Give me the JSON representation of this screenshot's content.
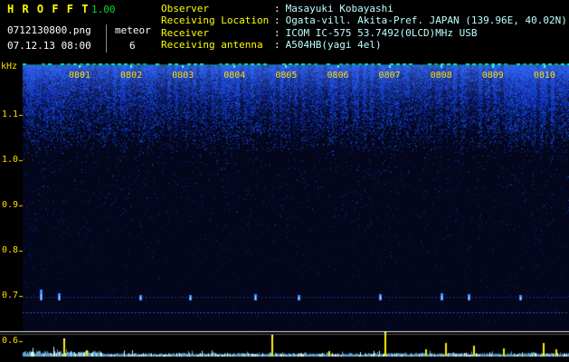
{
  "app": {
    "name": "H R O F F T",
    "version": "1.00",
    "filename": "0712130800.png",
    "counter_label": "meteor",
    "counter_value": "6",
    "timestamp": "07.12.13 08:00"
  },
  "info": {
    "rows": [
      {
        "label": "Observer",
        "sep": ":",
        "value": "Masayuki Kobayashi"
      },
      {
        "label": "Receiving Location",
        "sep": ":",
        "value": "Ogata-vill. Akita-Pref. JAPAN (139.96E, 40.02N)"
      },
      {
        "label": "Receiver",
        "sep": ":",
        "value": "ICOM IC-575 53.7492(0LCD)MHz USB"
      },
      {
        "label": "Receiving antenna",
        "sep": ":",
        "value": "A504HB(yagi 4el)"
      }
    ]
  },
  "chart_data": {
    "type": "heatmap",
    "title": "HROFFT 10-minute radio meteor spectrogram 07.12.13 08:00-08:10",
    "x_ticks": [
      "0801",
      "0802",
      "0803",
      "0804",
      "0805",
      "0806",
      "0807",
      "0808",
      "0809",
      "0810"
    ],
    "y_unit": "kHz",
    "y_ticks": [
      "1.1",
      "1.0",
      "0.9",
      "0.8",
      "0.7",
      "0.6"
    ],
    "y_range_khz": [
      0.6,
      1.2
    ],
    "carrier_lines_khz": [
      0.7,
      0.66
    ],
    "meteor_count": 6,
    "echoes": [
      {
        "x": 0.033,
        "h": 10
      },
      {
        "x": 0.066,
        "h": 6
      },
      {
        "x": 0.215,
        "h": 4
      },
      {
        "x": 0.306,
        "h": 4
      },
      {
        "x": 0.425,
        "h": 5
      },
      {
        "x": 0.505,
        "h": 4
      },
      {
        "x": 0.654,
        "h": 5
      },
      {
        "x": 0.766,
        "h": 6
      },
      {
        "x": 0.816,
        "h": 5
      },
      {
        "x": 0.91,
        "h": 4
      }
    ],
    "power_spikes": [
      {
        "x": 0.074,
        "h": 18
      },
      {
        "x": 0.116,
        "h": 6
      },
      {
        "x": 0.455,
        "h": 22
      },
      {
        "x": 0.56,
        "h": 5
      },
      {
        "x": 0.662,
        "h": 26
      },
      {
        "x": 0.737,
        "h": 7
      },
      {
        "x": 0.773,
        "h": 14
      },
      {
        "x": 0.824,
        "h": 11
      },
      {
        "x": 0.879,
        "h": 8
      },
      {
        "x": 0.952,
        "h": 14
      },
      {
        "x": 0.975,
        "h": 7
      }
    ],
    "legend": "off",
    "grid": "off"
  },
  "colors": {
    "title": "#ffff00",
    "version": "#00dd33",
    "label": "#ffff00",
    "value": "#bfffff",
    "white": "#ffffff",
    "axis": "#ffdd00",
    "spike": "#ffee00",
    "echo": "#3c8cff",
    "background": "#000000"
  }
}
